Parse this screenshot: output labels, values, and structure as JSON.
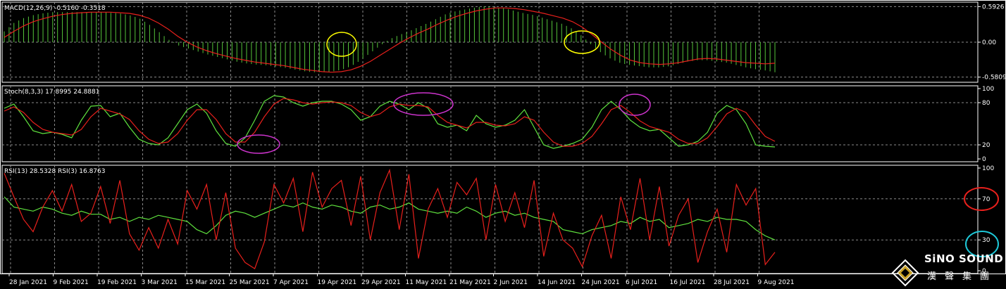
{
  "chart_data": [
    {
      "type": "bar+line",
      "indicator": "MACD",
      "label": "MACD(12,26,9) -0.5160 -0.3518",
      "y_ticks": [
        "0.5926",
        "0.00",
        "-0.5809"
      ],
      "ylim": [
        -0.62,
        0.62
      ],
      "series": [
        {
          "name": "MACD",
          "kind": "histogram",
          "color": "#55c43a",
          "values": [
            0.18,
            0.32,
            0.4,
            0.45,
            0.48,
            0.5,
            0.5,
            0.5,
            0.5,
            0.5,
            0.5,
            0.49,
            0.48,
            0.45,
            0.4,
            0.3,
            0.18,
            0.05,
            -0.05,
            -0.1,
            -0.15,
            -0.2,
            -0.24,
            -0.28,
            -0.32,
            -0.35,
            -0.37,
            -0.38,
            -0.4,
            -0.42,
            -0.45,
            -0.48,
            -0.5,
            -0.5,
            -0.49,
            -0.46,
            -0.4,
            -0.3,
            -0.18,
            -0.06,
            0.05,
            0.12,
            0.18,
            0.25,
            0.32,
            0.4,
            0.48,
            0.52,
            0.55,
            0.58,
            0.6,
            0.58,
            0.56,
            0.52,
            0.48,
            0.45,
            0.4,
            0.35,
            0.3,
            0.22,
            0.1,
            -0.05,
            -0.18,
            -0.28,
            -0.35,
            -0.38,
            -0.4,
            -0.42,
            -0.42,
            -0.4,
            -0.36,
            -0.32,
            -0.3,
            -0.3,
            -0.32,
            -0.34,
            -0.38,
            -0.42,
            -0.45,
            -0.47,
            -0.5
          ]
        },
        {
          "name": "Signal",
          "kind": "line",
          "color": "#e8201c",
          "values": [
            0.08,
            0.18,
            0.27,
            0.34,
            0.39,
            0.43,
            0.46,
            0.48,
            0.49,
            0.5,
            0.5,
            0.5,
            0.49,
            0.48,
            0.45,
            0.4,
            0.32,
            0.22,
            0.1,
            0.0,
            -0.08,
            -0.14,
            -0.19,
            -0.23,
            -0.27,
            -0.3,
            -0.33,
            -0.35,
            -0.37,
            -0.39,
            -0.42,
            -0.45,
            -0.47,
            -0.49,
            -0.5,
            -0.49,
            -0.46,
            -0.4,
            -0.32,
            -0.22,
            -0.12,
            -0.02,
            0.07,
            0.15,
            0.22,
            0.3,
            0.37,
            0.43,
            0.48,
            0.52,
            0.55,
            0.57,
            0.57,
            0.56,
            0.54,
            0.51,
            0.48,
            0.44,
            0.4,
            0.34,
            0.25,
            0.13,
            0.0,
            -0.12,
            -0.22,
            -0.3,
            -0.34,
            -0.36,
            -0.37,
            -0.36,
            -0.34,
            -0.31,
            -0.28,
            -0.27,
            -0.28,
            -0.3,
            -0.32,
            -0.34,
            -0.35,
            -0.36,
            -0.35
          ]
        }
      ]
    },
    {
      "type": "line",
      "indicator": "Stochastic",
      "label": "Stoch(8,3,3) 17.8995 24.8881",
      "y_ticks": [
        "100",
        "80",
        "20",
        "0"
      ],
      "ylim": [
        0,
        100
      ],
      "series": [
        {
          "name": "%K",
          "color": "#5fe23e",
          "values": [
            72,
            78,
            60,
            40,
            36,
            38,
            35,
            30,
            55,
            75,
            76,
            60,
            65,
            45,
            28,
            22,
            20,
            30,
            50,
            70,
            78,
            65,
            40,
            22,
            18,
            30,
            55,
            82,
            90,
            88,
            80,
            75,
            80,
            82,
            82,
            78,
            70,
            55,
            60,
            75,
            82,
            78,
            70,
            80,
            72,
            50,
            45,
            48,
            40,
            62,
            50,
            45,
            48,
            55,
            70,
            45,
            20,
            15,
            18,
            22,
            28,
            45,
            70,
            82,
            70,
            55,
            45,
            40,
            42,
            30,
            18,
            20,
            25,
            38,
            65,
            76,
            70,
            50,
            20,
            18,
            17
          ]
        },
        {
          "name": "%D",
          "color": "#e8201c",
          "values": [
            68,
            74,
            66,
            52,
            42,
            38,
            36,
            34,
            42,
            60,
            72,
            68,
            64,
            56,
            40,
            28,
            22,
            24,
            36,
            55,
            70,
            70,
            56,
            36,
            24,
            24,
            38,
            60,
            78,
            86,
            84,
            80,
            78,
            80,
            81,
            80,
            76,
            66,
            60,
            64,
            74,
            78,
            76,
            76,
            74,
            62,
            52,
            48,
            44,
            52,
            52,
            48,
            47,
            50,
            60,
            55,
            38,
            24,
            18,
            18,
            22,
            32,
            50,
            70,
            76,
            66,
            54,
            46,
            42,
            38,
            28,
            22,
            22,
            30,
            46,
            64,
            72,
            66,
            48,
            32,
            25
          ]
        }
      ]
    },
    {
      "type": "line",
      "indicator": "RSI",
      "label": "RSI(13) 28.5328  RSI(3) 16.8763",
      "y_ticks": [
        "100",
        "70",
        "30",
        "0"
      ],
      "ylim": [
        0,
        100
      ],
      "series": [
        {
          "name": "RSI(13)",
          "color": "#5fe23e",
          "values": [
            72,
            62,
            60,
            58,
            62,
            60,
            56,
            54,
            58,
            55,
            55,
            50,
            52,
            48,
            52,
            50,
            54,
            52,
            50,
            48,
            40,
            36,
            44,
            54,
            58,
            56,
            52,
            56,
            60,
            64,
            62,
            66,
            62,
            60,
            64,
            62,
            58,
            56,
            62,
            64,
            60,
            62,
            66,
            60,
            58,
            56,
            58,
            56,
            62,
            58,
            52,
            56,
            58,
            54,
            56,
            52,
            50,
            48,
            40,
            38,
            36,
            40,
            42,
            44,
            48,
            46,
            52,
            48,
            50,
            42,
            44,
            46,
            50,
            48,
            52,
            50,
            50,
            48,
            40,
            34,
            30
          ]
        },
        {
          "name": "RSI(3)",
          "color": "#e8201c",
          "values": [
            95,
            72,
            50,
            38,
            62,
            78,
            58,
            84,
            48,
            56,
            82,
            46,
            88,
            36,
            20,
            42,
            22,
            50,
            26,
            78,
            60,
            84,
            30,
            76,
            22,
            8,
            2,
            28,
            84,
            66,
            90,
            38,
            96,
            62,
            80,
            88,
            44,
            92,
            30,
            76,
            98,
            40,
            94,
            12,
            60,
            80,
            52,
            86,
            74,
            90,
            30,
            84,
            48,
            76,
            42,
            88,
            14,
            56,
            30,
            22,
            4,
            34,
            54,
            12,
            72,
            40,
            90,
            30,
            82,
            24,
            54,
            70,
            8,
            38,
            60,
            18,
            84,
            64,
            80,
            6,
            18
          ]
        }
      ]
    }
  ],
  "x_tick_labels": [
    "28 Jan 2021",
    "9 Feb 2021",
    "19 Feb 2021",
    "3 Mar 2021",
    "15 Mar 2021",
    "25 Mar 2021",
    "7 Apr 2021",
    "19 Apr 2021",
    "29 Apr 2021",
    "11 May 2021",
    "21 May 2021",
    "2 Jun 2021",
    "14 Jun 2021",
    "24 Jun 2021",
    "6 Jul 2021",
    "16 Jul 2021",
    "28 Jul 2021",
    "9 Aug 2021"
  ],
  "annotations": {
    "macd_circle_color": "#ffff00",
    "stoch_circle_color": "#cc33cc",
    "rsi_70_circle_color": "#e8201c",
    "rsi_30_circle_color": "#1ec8d8"
  },
  "logo": {
    "name": "SiNO SOUND",
    "cn": "漢聲集團"
  }
}
